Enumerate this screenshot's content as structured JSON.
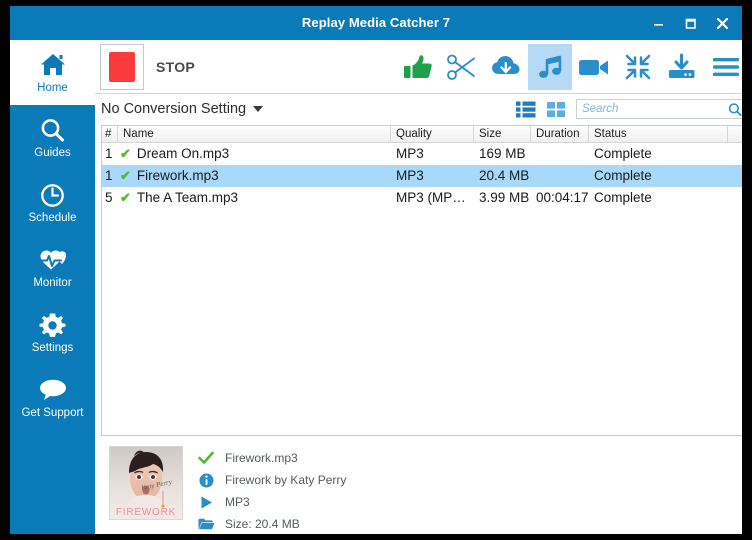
{
  "window": {
    "title": "Replay Media Catcher 7",
    "controls": {
      "minimize": "minimize-icon",
      "maximize": "maximize-icon",
      "close": "close-icon"
    }
  },
  "colors": {
    "brand_blue": "#0b7ab8",
    "icon_blue": "#2a8ecb",
    "active_toolbar_bg": "#b6d9f5",
    "selected_row": "#a8d8fa",
    "stop_red": "#fb3b3b",
    "check_green": "#53b82f"
  },
  "sidebar": {
    "items": [
      {
        "label": "Home",
        "icon": "home-icon",
        "active": true
      },
      {
        "label": "Guides",
        "icon": "search-icon",
        "active": false
      },
      {
        "label": "Schedule",
        "icon": "clock-icon",
        "active": false
      },
      {
        "label": "Monitor",
        "icon": "heart-pulse-icon",
        "active": false
      },
      {
        "label": "Settings",
        "icon": "gear-icon",
        "active": false
      },
      {
        "label": "Get Support",
        "icon": "chat-bubble-icon",
        "active": false
      }
    ]
  },
  "toolbar": {
    "stop_label": "STOP",
    "stop_icon": "stop-square-icon",
    "buttons": [
      {
        "name": "thumbs-up-icon",
        "active": false
      },
      {
        "name": "scissors-icon",
        "active": false
      },
      {
        "name": "cloud-download-icon",
        "active": false
      },
      {
        "name": "music-note-icon",
        "active": true
      },
      {
        "name": "video-camera-icon",
        "active": false
      },
      {
        "name": "compress-icon",
        "active": false
      },
      {
        "name": "save-download-icon",
        "active": false
      },
      {
        "name": "hamburger-menu-icon",
        "active": false
      }
    ]
  },
  "subbar": {
    "conversion_setting": "No Conversion Setting",
    "list_view_icon": "list-view-icon",
    "grid_view_icon": "grid-view-icon",
    "search": {
      "placeholder": "Search",
      "value": "",
      "icon": "search-icon"
    }
  },
  "list": {
    "columns": [
      {
        "key": "num",
        "label": "#"
      },
      {
        "key": "name",
        "label": "Name"
      },
      {
        "key": "quality",
        "label": "Quality"
      },
      {
        "key": "size",
        "label": "Size"
      },
      {
        "key": "duration",
        "label": "Duration"
      },
      {
        "key": "status",
        "label": "Status"
      },
      {
        "key": "end",
        "label": ""
      }
    ],
    "rows": [
      {
        "num": "1",
        "check": "✔",
        "name": "Dream On.mp3",
        "quality": "MP3",
        "size": "169 MB",
        "duration": "",
        "status": "Complete",
        "selected": false
      },
      {
        "num": "1",
        "check": "✔",
        "name": "Firework.mp3",
        "quality": "MP3",
        "size": "20.4 MB",
        "duration": "",
        "status": "Complete",
        "selected": true
      },
      {
        "num": "5",
        "check": "✔",
        "name": "The A Team.mp3",
        "quality": "MP3 (MP…",
        "size": "3.99 MB",
        "duration": "00:04:17",
        "status": "Complete",
        "selected": false
      }
    ]
  },
  "detail": {
    "thumbnail_alt": "Katy Perry Firework album art",
    "lines": [
      {
        "icon": "check-icon",
        "text": "Firework.mp3"
      },
      {
        "icon": "info-icon",
        "text": "Firework by Katy Perry"
      },
      {
        "icon": "play-icon",
        "text": "MP3"
      },
      {
        "icon": "folder-icon",
        "text": "Size:   20.4 MB"
      }
    ]
  }
}
